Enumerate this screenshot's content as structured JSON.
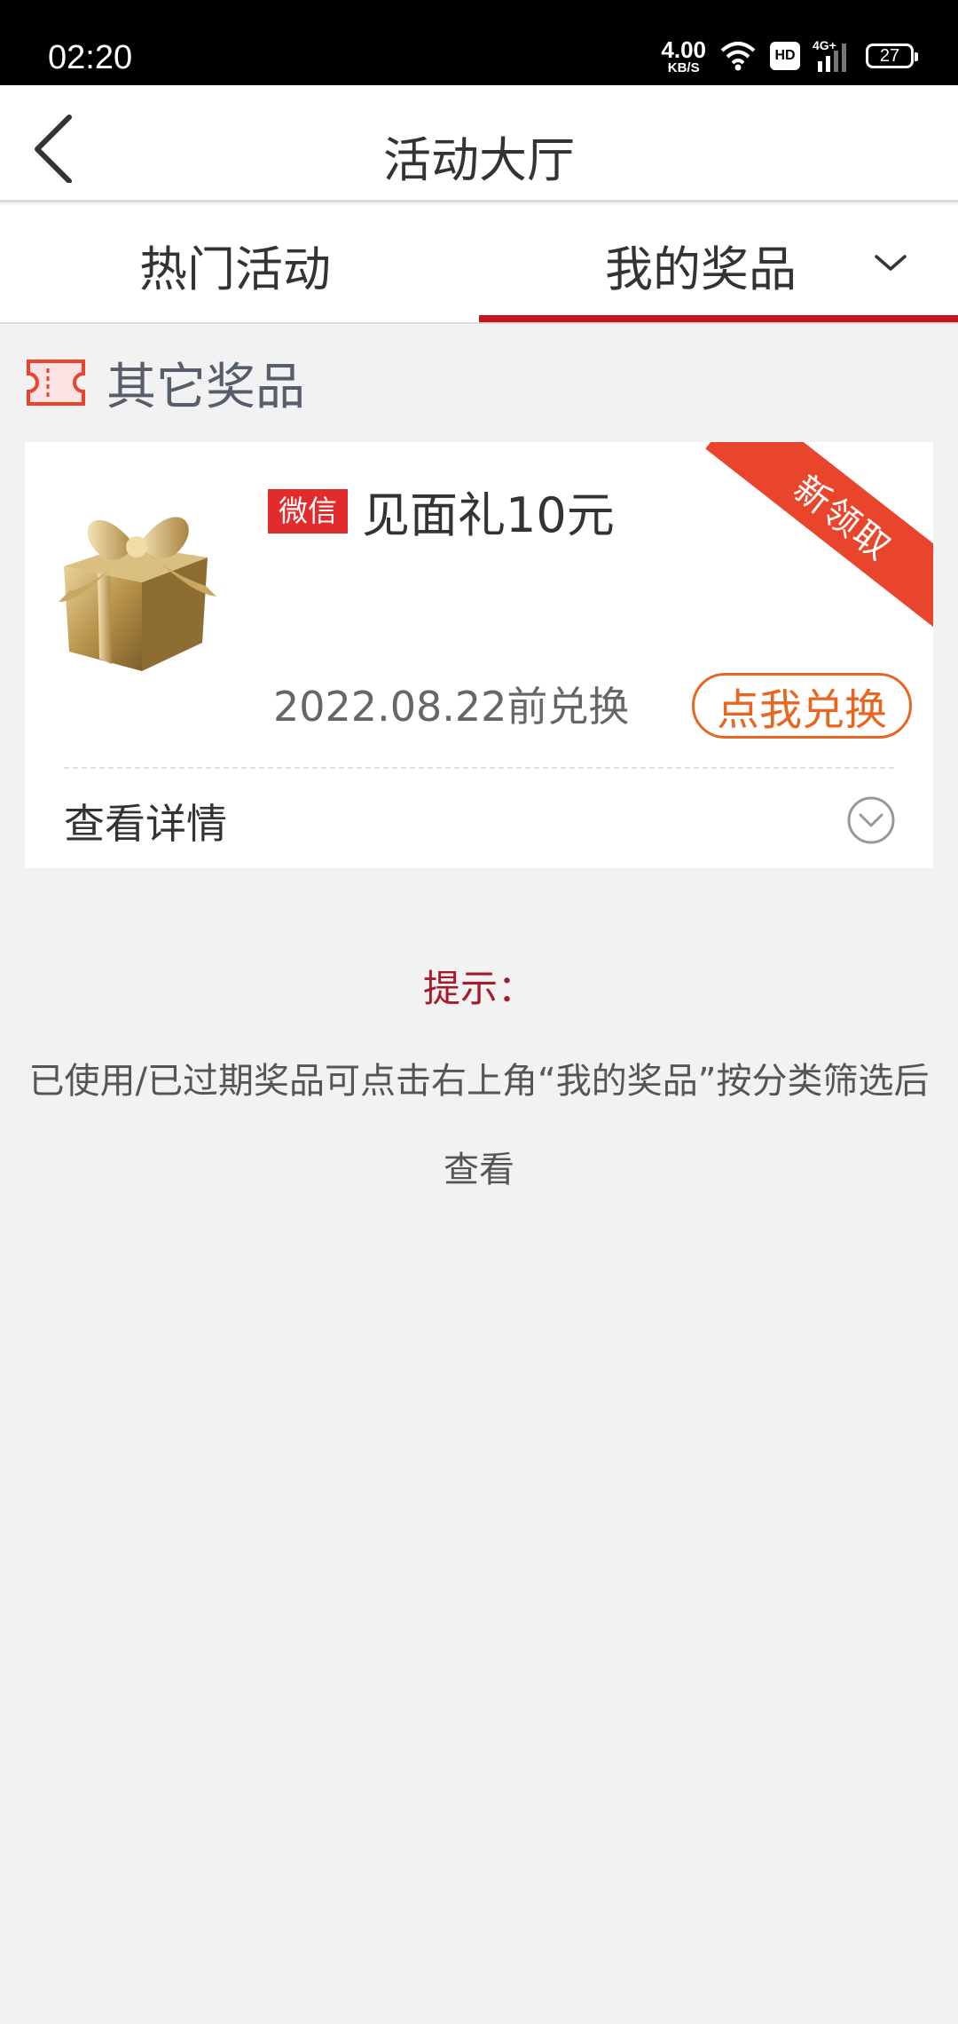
{
  "status_bar": {
    "time": "02:20",
    "net_speed_value": "4.00",
    "net_speed_unit": "KB/S",
    "hd_label": "HD",
    "network_type": "4G+",
    "battery": "27",
    "icons": [
      "wifi-icon",
      "signal-icon",
      "battery-icon"
    ]
  },
  "nav": {
    "title": "活动大厅",
    "back_icon": "chevron-left-icon"
  },
  "tabs": [
    {
      "label": "热门活动",
      "selected": false
    },
    {
      "label": "我的奖品",
      "selected": true,
      "icon": "chevron-down-icon"
    }
  ],
  "section": {
    "title": "其它奖品",
    "icon": "ticket-icon"
  },
  "prize": {
    "tag": "微信",
    "name": "见面礼10元",
    "ribbon": "新领取",
    "expire": "2022.08.22前兑换",
    "redeem_label": "点我兑换",
    "details_label": "查看详情",
    "image_icon": "gift-box-icon",
    "details_icon": "chevron-down-circle-icon"
  },
  "tip": {
    "title": "提示：",
    "text": "已使用/已过期奖品可点击右上角“我的奖品”按分类筛选后查看"
  },
  "colors": {
    "accent_red": "#c8141f",
    "ribbon": "#e8452c",
    "redeem_orange": "#e8661f",
    "wechat_tag": "#e22b2b",
    "tip_title": "#a71a2a",
    "background": "#f2f2f2"
  }
}
